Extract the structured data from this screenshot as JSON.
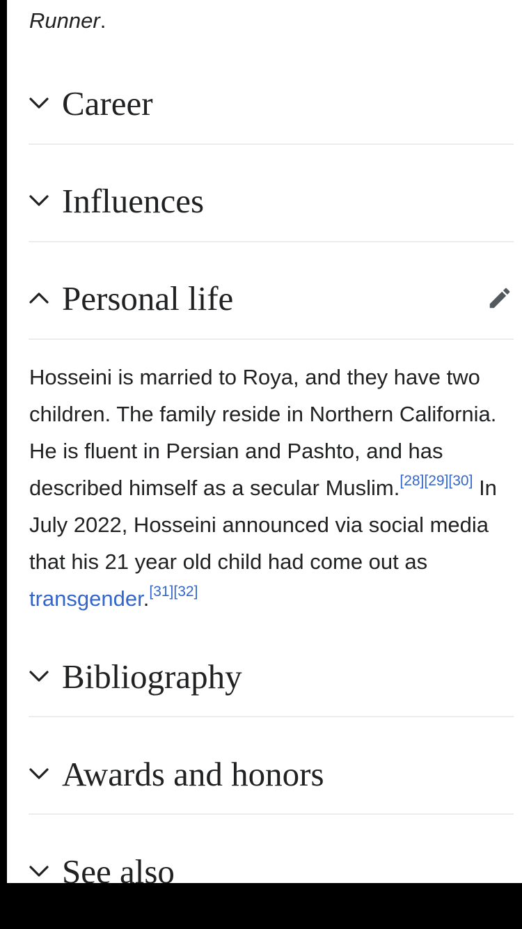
{
  "previous_section_tail": {
    "italic": "Runner",
    "tail": "."
  },
  "sections": {
    "career": {
      "title": "Career",
      "state": "collapsed",
      "icon": "chevron-down-icon"
    },
    "influences": {
      "title": "Influences",
      "state": "collapsed",
      "icon": "chevron-down-icon"
    },
    "personal_life": {
      "title": "Personal life",
      "state": "expanded",
      "icon": "chevron-up-icon",
      "edit_icon": "pencil-edit-icon"
    },
    "bibliography": {
      "title": "Bibliography",
      "state": "collapsed",
      "icon": "chevron-down-icon"
    },
    "awards": {
      "title": "Awards and honors",
      "state": "collapsed",
      "icon": "chevron-down-icon"
    },
    "see_also": {
      "title": "See also",
      "state": "collapsed",
      "icon": "chevron-down-icon"
    }
  },
  "personal_life_body": {
    "text_1": "Hosseini is married to Roya, and they have two children. The family reside in Northern California. He is fluent in Persian and Pashto, and has described himself as a secular Muslim.",
    "ref_28": "[28]",
    "ref_29": "[29]",
    "ref_30": "[30]",
    "text_2": " In July 2022, Hosseini announced via social media that his 21 year old child had come out as ",
    "link_transgender": "transgender",
    "text_3": ".",
    "ref_31": "[31]",
    "ref_32": "[32]"
  },
  "colors": {
    "text": "#202122",
    "link": "#3366cc",
    "divider": "#eaecf0",
    "background": "#ffffff",
    "frame": "#000000"
  }
}
